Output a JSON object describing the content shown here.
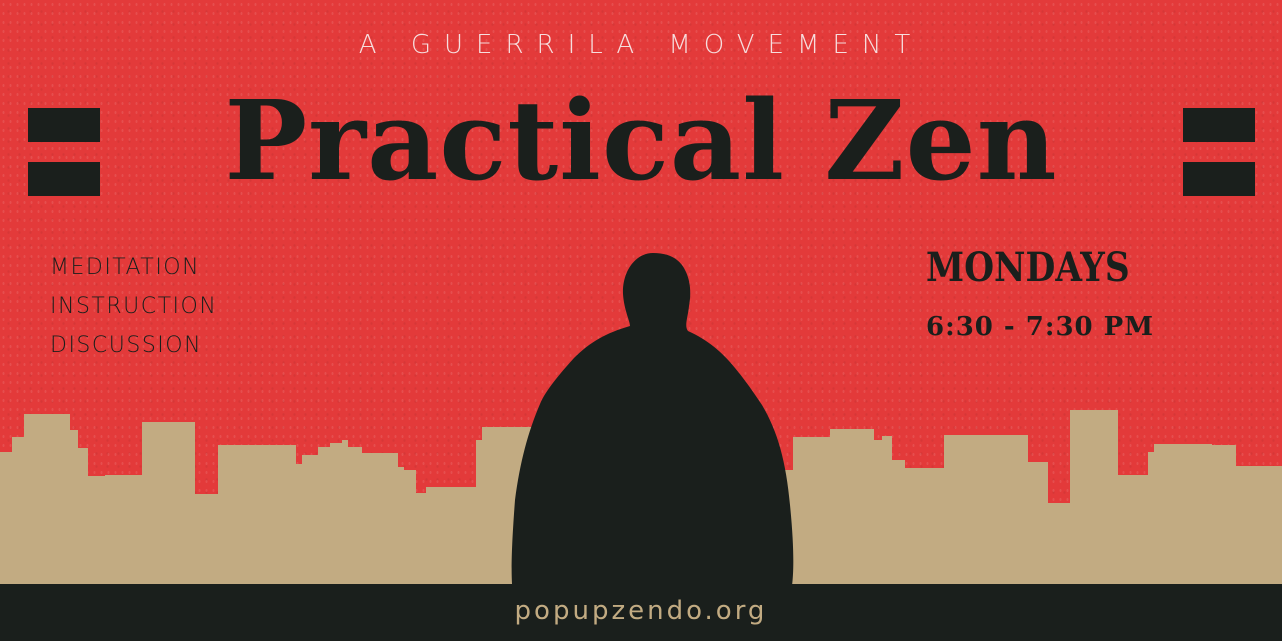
{
  "poster": {
    "tagline": "A GUERRILA MOVEMENT",
    "title": "Practical Zen",
    "activities": [
      "MEDITATION",
      "INSTRUCTION",
      "DISCUSSION"
    ],
    "day": "MONDAYS",
    "time": "6:30 - 7:30 PM",
    "website": "popupzendo.org"
  },
  "colors": {
    "background": "#e33a3a",
    "ink": "#1a1f1c",
    "skyline": "#c2ab82"
  },
  "icons": [
    "meditating-figure-silhouette",
    "city-skyline",
    "equals-bars"
  ]
}
